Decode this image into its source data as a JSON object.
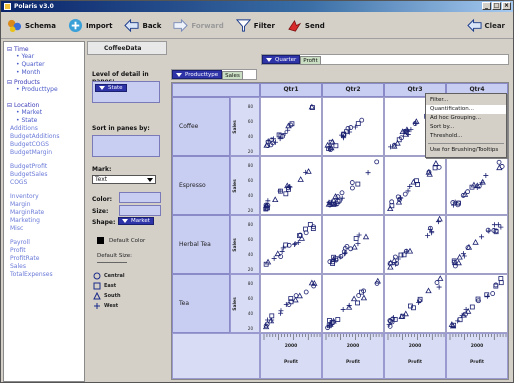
{
  "window": {
    "title": "Polaris v3.0",
    "controls": [
      "_",
      "□",
      "×"
    ]
  },
  "toolbar": {
    "schema": "Schema",
    "import": "Import",
    "back": "Back",
    "forward": "Forward",
    "filter": "Filter",
    "send": "Send",
    "clear": "Clear"
  },
  "schema": {
    "time_label": "Time",
    "time_items": [
      "Year",
      "Quarter",
      "Month"
    ],
    "products_label": "Products",
    "products_items": [
      "Producttype"
    ],
    "location_label": "Location",
    "location_items": [
      "Market",
      "State"
    ],
    "fields_a": [
      "Additions",
      "BudgetAdditions",
      "BudgetCOGS",
      "BudgetMargin"
    ],
    "fields_b": [
      "BudgetProfit",
      "BudgetSales",
      "COGS"
    ],
    "fields_c": [
      "Inventory",
      "Margin",
      "MarginRate",
      "Marketing",
      "Misc"
    ],
    "fields_d": [
      "Payroll",
      "Profit",
      "ProfitRate",
      "Sales",
      "TotalExpenses"
    ]
  },
  "config": {
    "tab": "CoffeeData",
    "level_label": "Level of detail in panes:",
    "level_pill": "State",
    "sort_label": "Sort in panes by:",
    "mark_label": "Mark:",
    "mark_value": "Text",
    "color_label": "Color:",
    "size_label": "Size:",
    "shape_label": "Shape:",
    "shape_pill": "Market",
    "default_color": "Default Color",
    "default_size": "Default Size:",
    "legend": [
      {
        "name": "Central",
        "shape": "circle"
      },
      {
        "name": "East",
        "shape": "square"
      },
      {
        "name": "South",
        "shape": "triangle"
      },
      {
        "name": "West",
        "shape": "plus"
      }
    ]
  },
  "shelves": {
    "columns_pill": "Quarter",
    "columns_pill2": "Profit",
    "rows_pill": "Producttype",
    "rows_pill2": "Sales"
  },
  "menu": {
    "items": [
      "Filter...",
      "Quantification...",
      "Ad hoc Grouping...",
      "Sort by...",
      "Threshold...",
      "Use for Brushing/Tooltips"
    ],
    "active_index": 1
  },
  "chart_data": {
    "type": "scatter",
    "columns": [
      "Qtr1",
      "Qtr2",
      "Qtr3",
      "Qtr4"
    ],
    "rows": [
      "Coffee",
      "Espresso",
      "Herbal Tea",
      "Tea"
    ],
    "ylabel": "Sales",
    "xlabel": "Profit",
    "x_tick": "2000",
    "y_ticks": [
      "80",
      "60",
      "40",
      "20"
    ]
  }
}
